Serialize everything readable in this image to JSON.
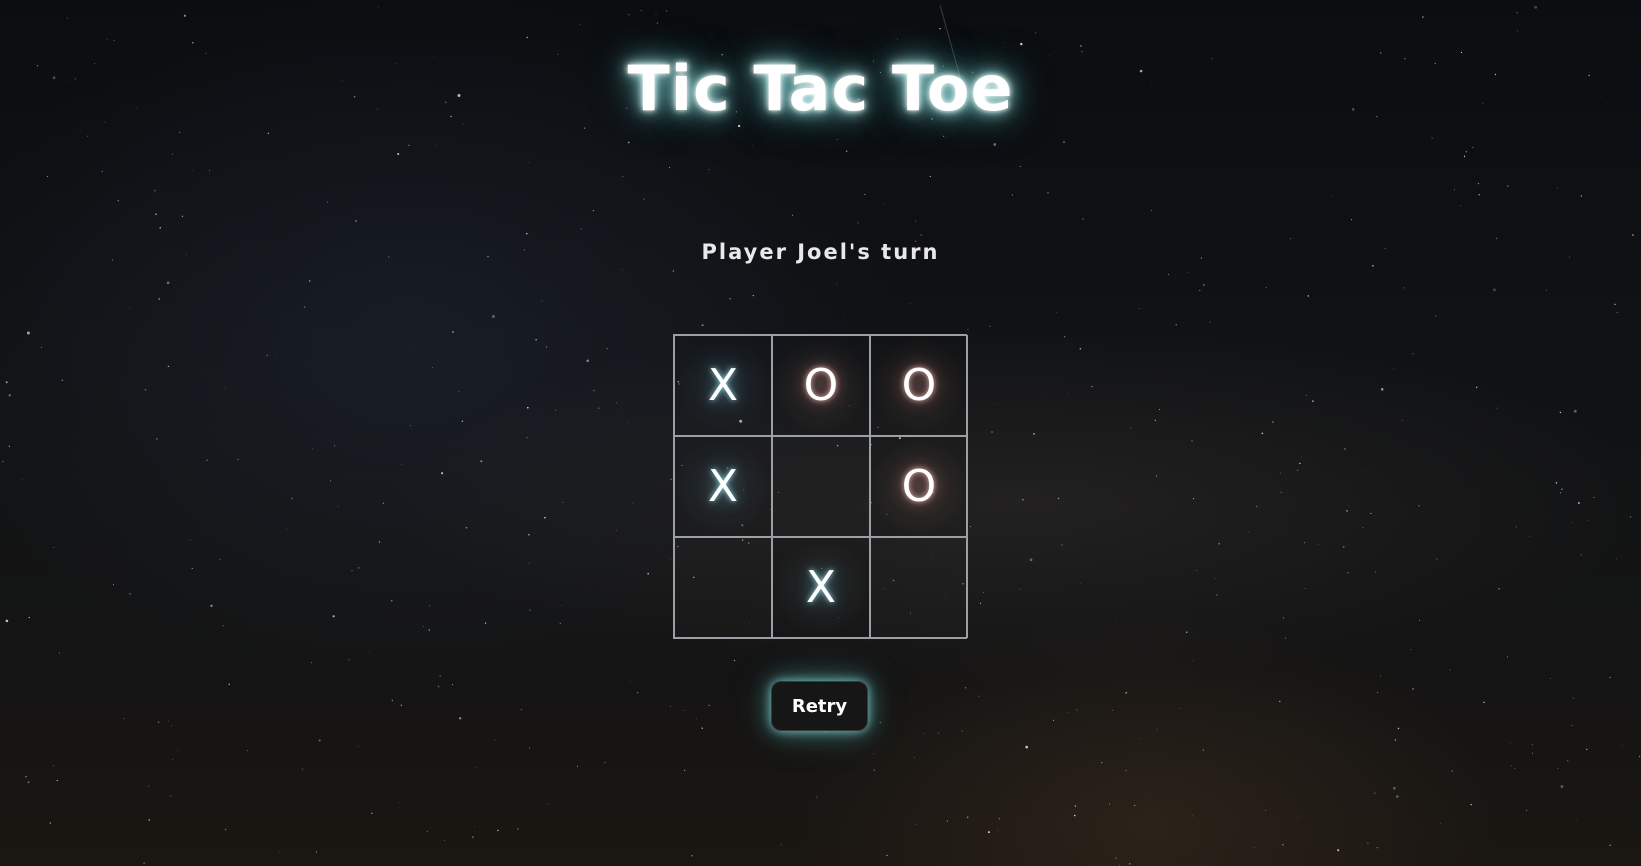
{
  "title": "Tic Tac Toe",
  "status": "Player Joel's turn",
  "board": {
    "cells": [
      "X",
      "O",
      "O",
      "X",
      "",
      "O",
      "",
      "X",
      ""
    ]
  },
  "retry_label": "Retry",
  "colors": {
    "background": "#0b0d10",
    "title_glow": "#7fe6e6",
    "grid_line": "#9aa0a6",
    "button_bg": "#161616"
  }
}
